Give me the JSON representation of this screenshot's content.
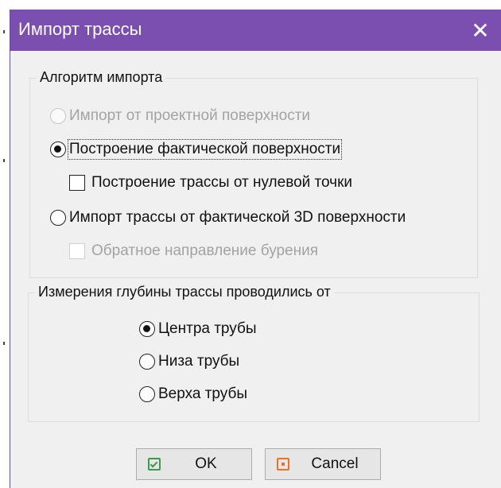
{
  "window": {
    "title": "Импорт трассы",
    "close_symbol": "✕"
  },
  "group_algorithm": {
    "legend": "Алгоритм импорта",
    "options": [
      {
        "label": "Импорт от проектной поверхности",
        "checked": false,
        "disabled": true
      },
      {
        "label": "Построение фактической поверхности",
        "checked": true,
        "disabled": false,
        "focused": true
      },
      {
        "label": "Импорт трассы от фактической 3D поверхности",
        "checked": false,
        "disabled": false
      }
    ],
    "checkbox_zero_point": {
      "label": "Построение трассы от нулевой точки",
      "checked": false,
      "disabled": false
    },
    "checkbox_reverse": {
      "label": "Обратное направление бурения",
      "checked": false,
      "disabled": true
    }
  },
  "group_depth": {
    "legend": "Измерения глубины трассы проводились от",
    "options": [
      {
        "label": "Центра трубы",
        "checked": true
      },
      {
        "label": "Низа трубы",
        "checked": false
      },
      {
        "label": "Верха трубы",
        "checked": false
      }
    ]
  },
  "buttons": {
    "ok": {
      "label": "OK",
      "icon": "check-icon",
      "icon_color": "#3d9a4a"
    },
    "cancel": {
      "label": "Cancel",
      "icon": "cancel-icon",
      "icon_color": "#e8712b"
    }
  },
  "colors": {
    "titlebar": "#7b4fb0",
    "window_bg": "#f0f0f0"
  }
}
